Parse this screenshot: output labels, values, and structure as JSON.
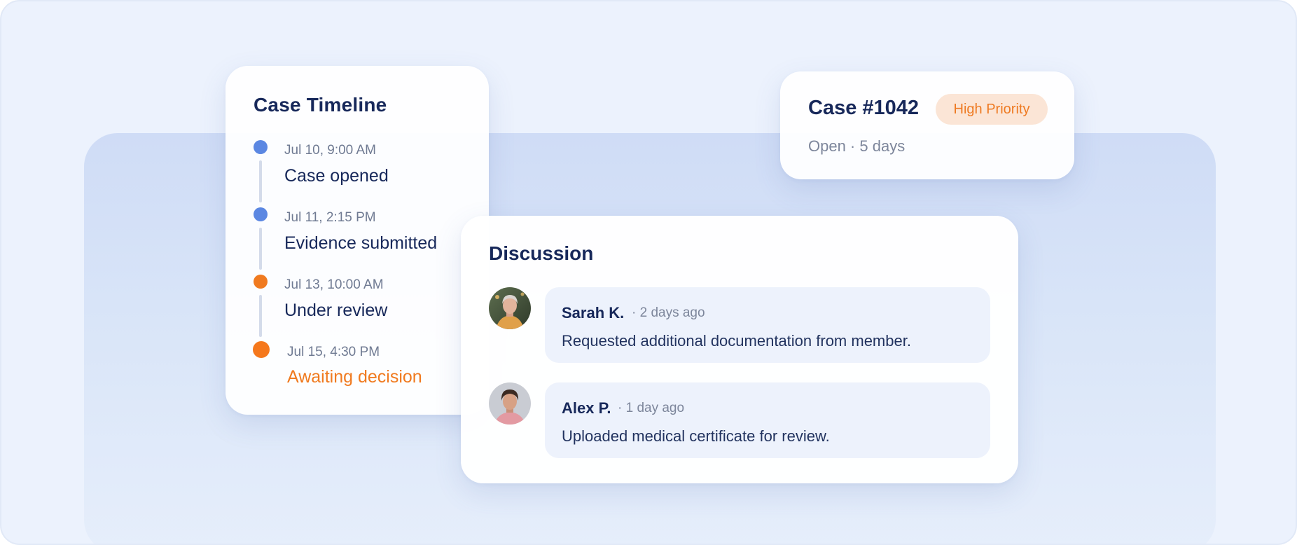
{
  "timeline": {
    "title": "Case Timeline",
    "events": [
      {
        "time": "Jul 10, 9:00 AM",
        "label": "Case opened",
        "status": "done"
      },
      {
        "time": "Jul 11, 2:15 PM",
        "label": "Evidence submitted",
        "status": "done"
      },
      {
        "time": "Jul 13, 10:00 AM",
        "label": "Under review",
        "status": "in-progress"
      },
      {
        "time": "Jul 15, 4:30 PM",
        "label": "Awaiting decision",
        "status": "current"
      }
    ]
  },
  "case": {
    "title": "Case #1042",
    "priority": "High Priority",
    "status": "Open · 5 days"
  },
  "discussion": {
    "title": "Discussion",
    "comments": [
      {
        "author": "Sarah K.",
        "ago": "· 2 days ago",
        "message": "Requested additional documentation from member."
      },
      {
        "author": "Alex P.",
        "ago": "· 1 day ago",
        "message": "Uploaded medical certificate for review."
      }
    ]
  },
  "colors": {
    "background": "#ecf2fd",
    "navy": "#17285a",
    "blue_dot": "#5b87e2",
    "orange": "#f07a1f",
    "badge_bg": "#fbe5d6",
    "bubble_bg": "#edf2fc"
  }
}
